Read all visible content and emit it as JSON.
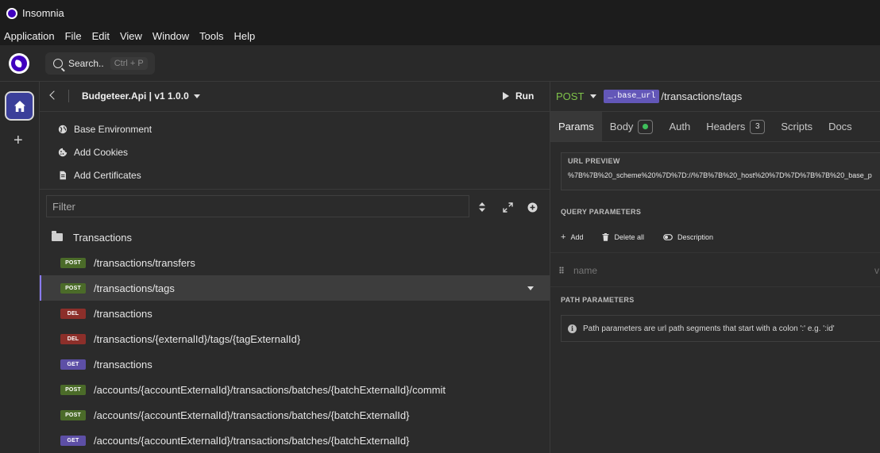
{
  "window": {
    "title": "Insomnia"
  },
  "menu": [
    "Application",
    "File",
    "Edit",
    "View",
    "Window",
    "Tools",
    "Help"
  ],
  "search": {
    "placeholder": "Search..",
    "shortcut": "Ctrl + P"
  },
  "project": {
    "name": "Budgeteer.Api | v1 1.0.0",
    "run_label": "Run"
  },
  "sidebar_links": [
    {
      "label": "Base Environment",
      "icon": "globe-icon"
    },
    {
      "label": "Add Cookies",
      "icon": "cookie-icon"
    },
    {
      "label": "Add Certificates",
      "icon": "certificate-icon"
    }
  ],
  "filter": {
    "placeholder": "Filter"
  },
  "folder": {
    "name": "Transactions"
  },
  "requests": [
    {
      "method": "POST",
      "path": "/transactions/transfers"
    },
    {
      "method": "POST",
      "path": "/transactions/tags",
      "active": true
    },
    {
      "method": "DEL",
      "path": "/transactions"
    },
    {
      "method": "DEL",
      "path": "/transactions/{externalId}/tags/{tagExternalId}"
    },
    {
      "method": "GET",
      "path": "/transactions"
    },
    {
      "method": "POST",
      "path": "/accounts/{accountExternalId}/transactions/batches/{batchExternalId}/commit"
    },
    {
      "method": "POST",
      "path": "/accounts/{accountExternalId}/transactions/batches/{batchExternalId}"
    },
    {
      "method": "GET",
      "path": "/accounts/{accountExternalId}/transactions/batches/{batchExternalId}"
    }
  ],
  "request": {
    "method": "POST",
    "variable": "_.base_url",
    "path": "/transactions/tags"
  },
  "tabs": {
    "params": "Params",
    "body": "Body",
    "auth": "Auth",
    "headers": "Headers",
    "headers_count": "3",
    "scripts": "Scripts",
    "docs": "Docs"
  },
  "url_preview": {
    "label": "URL PREVIEW",
    "value": "%7B%7B%20_scheme%20%7D%7D://%7B%7B%20_host%20%7D%7D%7B%7B%20_base_p"
  },
  "query_params": {
    "label": "QUERY PARAMETERS",
    "add": "Add",
    "delete_all": "Delete all",
    "description": "Description",
    "name_placeholder": "name",
    "value_hint": "v"
  },
  "path_params": {
    "label": "PATH PARAMETERS",
    "info": "Path parameters are url path segments that start with a colon ':' e.g. ':id'"
  },
  "colors": {
    "post": "#4b6b29",
    "del": "#8c2f2a",
    "get": "#5d4fa6",
    "accent": "#4000bf"
  }
}
